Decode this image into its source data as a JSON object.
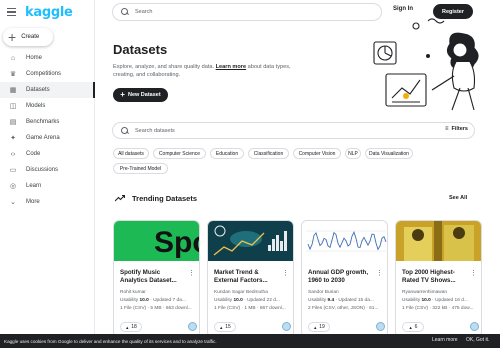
{
  "brand": {
    "logo": "kaggle"
  },
  "header": {
    "search_placeholder": "Search",
    "signin_label": "Sign In",
    "register_label": "Register"
  },
  "sidebar": {
    "create_label": "Create",
    "items": [
      {
        "label": "Home",
        "icon": "home-icon",
        "glyph": "⌂"
      },
      {
        "label": "Competitions",
        "icon": "trophy-icon",
        "glyph": "♛"
      },
      {
        "label": "Datasets",
        "icon": "table-icon",
        "glyph": "▦",
        "active": true
      },
      {
        "label": "Models",
        "icon": "models-icon",
        "glyph": "◫"
      },
      {
        "label": "Benchmarks",
        "icon": "benchmarks-icon",
        "glyph": "▤"
      },
      {
        "label": "Game Arena",
        "icon": "game-arena-icon",
        "glyph": "✦"
      },
      {
        "label": "Code",
        "icon": "code-icon",
        "glyph": "‹›"
      },
      {
        "label": "Discussions",
        "icon": "discussions-icon",
        "glyph": "▭"
      },
      {
        "label": "Learn",
        "icon": "learn-icon",
        "glyph": "◎"
      },
      {
        "label": "More",
        "icon": "chevron-down-icon",
        "glyph": "⌄"
      }
    ]
  },
  "hero": {
    "title": "Datasets",
    "desc_before": "Explore, analyze, and share quality data. ",
    "learn_more": "Learn more",
    "desc_after": " about data types, creating, and collaborating.",
    "new_dataset_label": "New Dataset"
  },
  "dataset_search": {
    "placeholder": "Search datasets",
    "filters_label": "Filters"
  },
  "chips": [
    "All datasets",
    "Computer Science",
    "Education",
    "Classification",
    "Computer Vision",
    "NLP",
    "Data Visualization",
    "Pre-Trained Model"
  ],
  "trending": {
    "title": "Trending Datasets",
    "see_all": "See All",
    "cards": [
      {
        "title": "Spotify Music Analytics Dataset...",
        "author": "Rohit kumar",
        "usability_label": "Usability ",
        "usability_value": "10.0",
        "updated": " · Updated 7 da...",
        "files": "1 File (CSV) · 5 MB · 663 downl...",
        "votes": "18",
        "thumb_text": "Spoti",
        "thumb_colors": {
          "bg": "#1db954",
          "fg": "#121212"
        }
      },
      {
        "title": "Market Trend & External Factors...",
        "author": "Kundan Sagar Bedmutha",
        "usability_label": "Usability ",
        "usability_value": "10.0",
        "updated": " · Updated 22 d...",
        "files": "1 File (CSV) · 1 MB · 867 downl...",
        "votes": "15",
        "thumb_colors": {
          "bg": "#0e3f4a",
          "fg": "#f2c14e"
        }
      },
      {
        "title": "Annual GDP growth, 1960 to 2030",
        "author": "Sandor Burian",
        "usability_label": "Usability ",
        "usability_value": "9.4",
        "updated": " · Updated 15 da...",
        "files": "2 Files (CSV, other, JSON) · 61...",
        "votes": "19",
        "thumb_colors": {
          "bg": "#ffffff",
          "fg": "#3d6fb5"
        }
      },
      {
        "title": "Top 2000 Highest-Rated TV Shows...",
        "author": "Ryanwarrenhimawan",
        "usability_label": "Usability ",
        "usability_value": "10.0",
        "updated": " · Updated 16 d...",
        "files": "1 File (CSV) · 322 kB · 475 dow...",
        "votes": "6",
        "thumb_colors": {
          "bg": "#c9a227",
          "fg": "#4a3b10"
        }
      }
    ]
  },
  "cookie": {
    "text": "Kaggle uses cookies from Google to deliver and enhance the quality of its services and to analyze traffic.",
    "learn_more": "Learn more",
    "ok": "OK, Got it."
  }
}
